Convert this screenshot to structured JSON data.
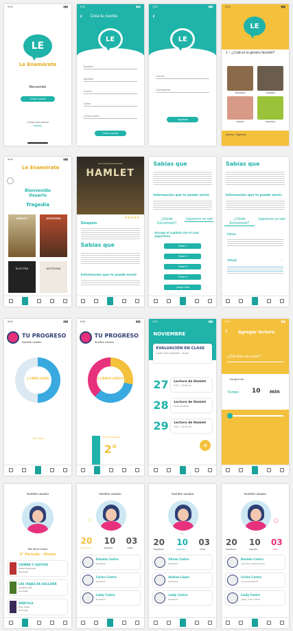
{
  "status": {
    "time": "9:41"
  },
  "nav": [
    "Inicio",
    "Perfil",
    "Libros",
    "Grupos",
    "Ajustes"
  ],
  "app": {
    "logo": "LE",
    "name": "Le Enamórate",
    "brand_teal": "#1fb3a9",
    "brand_yellow": "#f4c13d",
    "brand_pink": "#e8317c"
  },
  "welcome": {
    "text": "Bienvenido",
    "button": "Crear cuenta",
    "link_q": "¿Tienes una cuenta?",
    "link": "Ingresar"
  },
  "register": {
    "title": "Crea tu cuenta",
    "fields": [
      "Nombre",
      "Apellido",
      "Correo",
      "Clave",
      "¿Eres lector?"
    ],
    "button": "Crear cuenta"
  },
  "login": {
    "fields": [
      "Correo",
      "Contraseña"
    ],
    "button": "Ingresar"
  },
  "genre": {
    "question": "1 – ¿Cuál es tu género favorito?",
    "options": [
      "TRAGEDIA",
      "COMEDIA",
      "DRAMA",
      "FANTASÍA"
    ],
    "footer": "Anterior / Siguiente"
  },
  "home": {
    "greeting": "Bienvenido Usuario",
    "genre": "Tragedia",
    "books": [
      "HAMLET",
      "ANTIGONA",
      "ELECTRA",
      "ANTÍGONA"
    ]
  },
  "hamlet": {
    "author": "WILLIAM SHAKESPEARE",
    "title": "HAMLET",
    "synopsis_title": "Sinopsis",
    "did_you_know": "Sabías que",
    "info": "Información que te puede servir"
  },
  "hamlet2": {
    "title": "Sabías que",
    "info": "Información que te puede servir",
    "where": "¿Dónde Encontrarlo?",
    "play": "Juguemos un rato",
    "choose": "Escoge el capítulo con el cual jugaremos",
    "parts": [
      "Parte 1",
      "Parte 2",
      "Parte 3",
      "Parte 4",
      "Juego final"
    ]
  },
  "hamlet3": {
    "title": "Sabías que",
    "info": "Información que te puede servir",
    "where": "¿Dónde Encontrarlo?",
    "play": "Juguemos un rato",
    "items": [
      "Físico",
      "Virtual"
    ]
  },
  "progress1": {
    "title": "TU PROGRESO",
    "user": "Nombre usuario",
    "center": "1 LIBRO LEÍDO",
    "label": "1 libro leído"
  },
  "progress2": {
    "title": "TU PROGRESO",
    "user": "Nombre usuario",
    "center": "3 LIBROS LEÍDOS",
    "level": "2°",
    "label": "Nivel alcanzado"
  },
  "calendar": {
    "month": "NOVIEMBRE",
    "event_title": "EVALUACIÓN EN CLASE",
    "event_time": "Lunes 3 de noviembre · 10 am",
    "items": [
      {
        "day": "27",
        "title": "Lectura de Hamlet",
        "time": "9:00 – 10:30 am"
      },
      {
        "day": "28",
        "title": "Lectura de Hamlet",
        "time": "Hora de clase"
      },
      {
        "day": "29",
        "title": "Lectura de Hamlet",
        "time": "9:00 – 10:30 am"
      }
    ]
  },
  "addread": {
    "title": "Agregar lectura",
    "question": "¿Qué libro vas a leer?",
    "timer_label": "Escoja el día",
    "time_label": "Tiempo:",
    "time_value": "10",
    "unit": "min"
  },
  "profile1": {
    "user": "Nombre usuario",
    "section": "Mis libros leídos",
    "level": "3° Periodo – Nivelo",
    "books": [
      {
        "title": "CRIMEN Y CASTIGO",
        "author": "Fiódor Dostoievski",
        "meta": "Terminado"
      },
      {
        "title": "LOS VIAJES DE GULLIVER",
        "author": "Jonathan Swift",
        "meta": "Terminado"
      },
      {
        "title": "DRÁCULA",
        "author": "Bram Stoker",
        "meta": "Terminado"
      }
    ]
  },
  "profile2": {
    "user": "Nombre usuario",
    "stats": [
      {
        "n": "20",
        "l": "Seguidores"
      },
      {
        "n": "10",
        "l": "Seguidos"
      },
      {
        "n": "03",
        "l": "Chats"
      }
    ],
    "people": [
      {
        "name": "Daniela Castro",
        "sub": "Estudiante"
      },
      {
        "name": "Carlos Castro",
        "sub": "Estudiante"
      },
      {
        "name": "Laidy Castro",
        "sub": "Estudiante"
      }
    ]
  },
  "profile3": {
    "user": "Nombre usuario",
    "stats": [
      {
        "n": "20",
        "l": "Seguidores"
      },
      {
        "n": "10",
        "l": "Seguidos"
      },
      {
        "n": "03",
        "l": "Chats"
      }
    ],
    "people": [
      {
        "name": "Olivan Castro",
        "sub": "Estudiante"
      },
      {
        "name": "Andrea López",
        "sub": "Estudiante"
      },
      {
        "name": "Laidy Castro",
        "sub": "Estudiante"
      }
    ]
  },
  "profile4": {
    "user": "Nombre usuario",
    "stats": [
      {
        "n": "20",
        "l": "Seguidores"
      },
      {
        "n": "10",
        "l": "Seguidos"
      },
      {
        "n": "03",
        "l": "Chats"
      }
    ],
    "people": [
      {
        "name": "Daniela Castro",
        "sub": "¿Qué libro estás leyendo?"
      },
      {
        "name": "Carlos Castro",
        "sub": "¿Te gustó Hamlet?"
      },
      {
        "name": "Laidy Castro",
        "sub": "¡Hola! ¿Cómo estás?"
      }
    ]
  }
}
